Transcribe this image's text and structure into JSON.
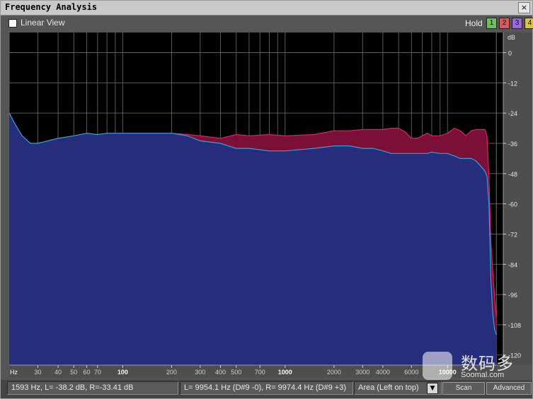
{
  "window": {
    "title": "Frequency Analysis"
  },
  "toolbar": {
    "linear_view_label": "Linear View",
    "linear_view_checked": false,
    "hold_label": "Hold",
    "hold_buttons": [
      {
        "label": "1",
        "color": "#6cbf5a"
      },
      {
        "label": "2",
        "color": "#d95b5b"
      },
      {
        "label": "3",
        "color": "#9a6ad6"
      },
      {
        "label": "4",
        "color": "#d6c24a"
      }
    ]
  },
  "chart_data": {
    "type": "area",
    "x_scale": "log",
    "xlim": [
      20,
      22050
    ],
    "ylim": [
      -124,
      8
    ],
    "xlabel": "Hz",
    "ylabel": "dB",
    "grid": true,
    "x_ticks": [
      {
        "value": 30,
        "label": "30"
      },
      {
        "value": 40,
        "label": "40"
      },
      {
        "value": 50,
        "label": "50"
      },
      {
        "value": 60,
        "label": "60"
      },
      {
        "value": 70,
        "label": "70"
      },
      {
        "value": 100,
        "label": "100"
      },
      {
        "value": 200,
        "label": "200"
      },
      {
        "value": 300,
        "label": "300"
      },
      {
        "value": 400,
        "label": "400"
      },
      {
        "value": 500,
        "label": "500"
      },
      {
        "value": 700,
        "label": "700"
      },
      {
        "value": 1000,
        "label": "1000"
      },
      {
        "value": 2000,
        "label": "2000"
      },
      {
        "value": 3000,
        "label": "3000"
      },
      {
        "value": 4000,
        "label": "4000"
      },
      {
        "value": 6000,
        "label": "6000"
      },
      {
        "value": 10000,
        "label": "10000"
      }
    ],
    "y_ticks": [
      0,
      -12,
      -24,
      -36,
      -48,
      -60,
      -72,
      -84,
      -96,
      -108,
      -120
    ],
    "series": [
      {
        "color": "#7a1038",
        "line_color": "#e0206a",
        "x": [
          20,
          22,
          24,
          27,
          30,
          40,
          50,
          60,
          70,
          80,
          100,
          150,
          200,
          250,
          300,
          400,
          500,
          600,
          800,
          1000,
          1500,
          2000,
          2500,
          3000,
          3500,
          4000,
          4500,
          5000,
          5500,
          6000,
          6500,
          7000,
          7500,
          8000,
          9000,
          10000,
          11000,
          12000,
          13000,
          14000,
          15000,
          16000,
          17000,
          17500,
          18000,
          18500,
          19000,
          19500,
          20000
        ],
        "values": [
          -24,
          -29,
          -33,
          -36,
          -36,
          -34,
          -33,
          -32,
          -32.5,
          -32,
          -32,
          -32,
          -32,
          -32.5,
          -33,
          -34,
          -32.5,
          -33,
          -32.5,
          -33,
          -32.5,
          -31,
          -31,
          -30.5,
          -30.5,
          -30.5,
          -30,
          -30,
          -31.5,
          -34,
          -34,
          -33,
          -32,
          -33,
          -33,
          -32,
          -30,
          -31,
          -33,
          -31,
          -30.5,
          -30.5,
          -30.5,
          -33,
          -50,
          -75,
          -87,
          -97,
          -105
        ]
      },
      {
        "color": "#262e7c",
        "line_color": "#2aa0e8",
        "x": [
          20,
          22,
          24,
          27,
          30,
          40,
          50,
          60,
          70,
          80,
          100,
          150,
          200,
          250,
          300,
          400,
          500,
          600,
          800,
          1000,
          1500,
          2000,
          2500,
          3000,
          3500,
          4000,
          4500,
          5000,
          5500,
          6000,
          6500,
          7000,
          7500,
          8000,
          9000,
          10000,
          11000,
          12000,
          13000,
          14000,
          15000,
          16000,
          17000,
          17500,
          18000,
          18500,
          19000,
          19500,
          20000
        ],
        "values": [
          -24,
          -29,
          -33,
          -36,
          -36,
          -34,
          -33,
          -32,
          -32.5,
          -32,
          -32,
          -32,
          -32,
          -33,
          -35,
          -36,
          -38,
          -38,
          -39,
          -39,
          -38,
          -37,
          -37,
          -38,
          -38,
          -39,
          -40,
          -40,
          -40,
          -40,
          -40,
          -40,
          -40,
          -39.5,
          -40,
          -40,
          -41,
          -42,
          -42,
          -42,
          -43,
          -45,
          -47,
          -49,
          -60,
          -90,
          -104,
          -110,
          -112
        ]
      }
    ]
  },
  "status": {
    "cursor_readout": "1593 Hz, L= -38.2 dB, R=-33.41 dB",
    "peak_readout": "L= 9954.1 Hz (D#9 -0), R= 9974.4 Hz (D#9 +3)",
    "display_mode": "Area (Left on top)",
    "scan_label": "Scan",
    "advanced_label": "Advanced"
  },
  "watermark": {
    "text": "数码多",
    "sub": "Soomal.com"
  }
}
